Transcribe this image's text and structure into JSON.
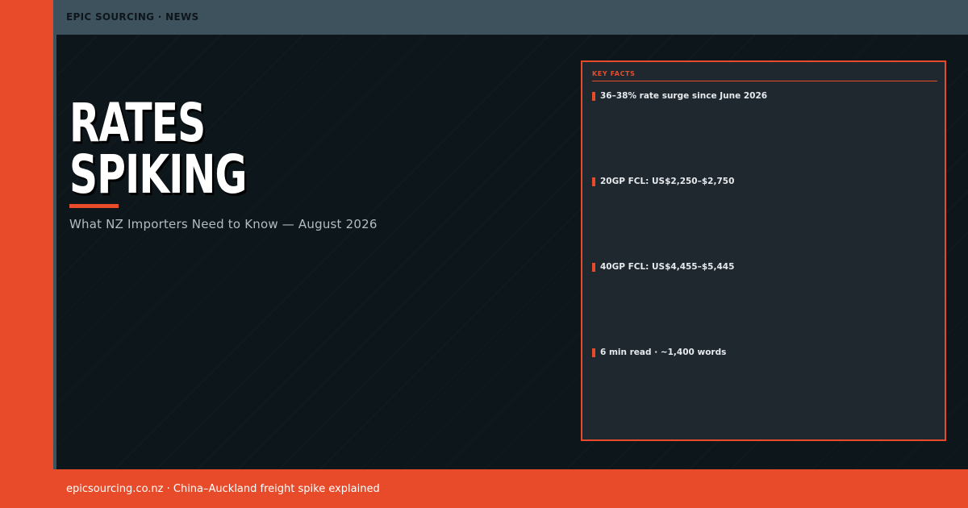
{
  "header": {
    "brand": "EPIC SOURCING · NEWS"
  },
  "hero": {
    "headline_line1": "RATES",
    "headline_line2": "SPIKING",
    "subtitle": "What NZ Importers Need to Know — August 2026"
  },
  "facts": {
    "title": "KEY FACTS",
    "items": [
      {
        "text": "36–38% rate surge since June 2026"
      },
      {
        "text": "20GP FCL: US$2,250–$2,750"
      },
      {
        "text": "40GP FCL: US$4,455–$5,445"
      },
      {
        "text": "6 min read · ~1,400 words"
      }
    ]
  },
  "footer": {
    "text": "epicsourcing.co.nz · China–Auckland freight spike explained"
  },
  "colors": {
    "accent": "#e84b2a",
    "background": "#0d161b",
    "bar": "#3e525d",
    "panel": "#1f282f"
  }
}
